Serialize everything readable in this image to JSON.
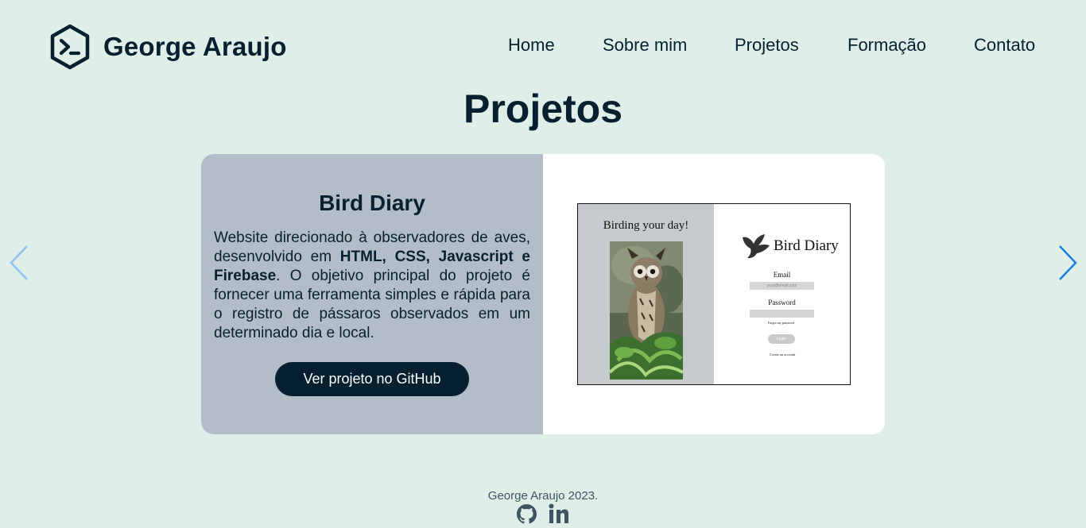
{
  "header": {
    "brand_name": "George Araujo",
    "logo_icon": "terminal-hexagon-icon",
    "nav": [
      {
        "label": "Home"
      },
      {
        "label": "Sobre mim"
      },
      {
        "label": "Projetos"
      },
      {
        "label": "Formação"
      },
      {
        "label": "Contato"
      }
    ]
  },
  "section": {
    "title": "Projetos"
  },
  "project": {
    "title": "Bird Diary",
    "description": {
      "part1": "Website direcionado à observadores de aves, desenvolvido em ",
      "bold": "HTML, CSS, Javascript e Firebase",
      "part2": ". O objetivo principal do projeto é fornecer uma ferramenta simples e rápida para o registro de pássaros observados em um determinado dia e local."
    },
    "button_label": "Ver projeto no GitHub",
    "screenshot": {
      "tagline": "Birding your day!",
      "brand": "Bird Diary",
      "email_label": "Email",
      "email_placeholder": "your@email.com",
      "password_label": "Password",
      "forgot_label": "Forgot my password",
      "login_label": "Login",
      "create_label": "Create an account"
    }
  },
  "carousel": {
    "prev_icon": "chevron-left-icon",
    "next_icon": "chevron-right-icon"
  },
  "footer": {
    "copyright": "George Araujo 2023.",
    "icons": [
      "github-icon",
      "linkedin-icon"
    ]
  },
  "colors": {
    "background": "#dfeee7",
    "primary_dark": "#06202f",
    "card_left": "#b3bdc8",
    "arrow_active": "#1a7fe0",
    "arrow_inactive": "#8ec3f2"
  }
}
